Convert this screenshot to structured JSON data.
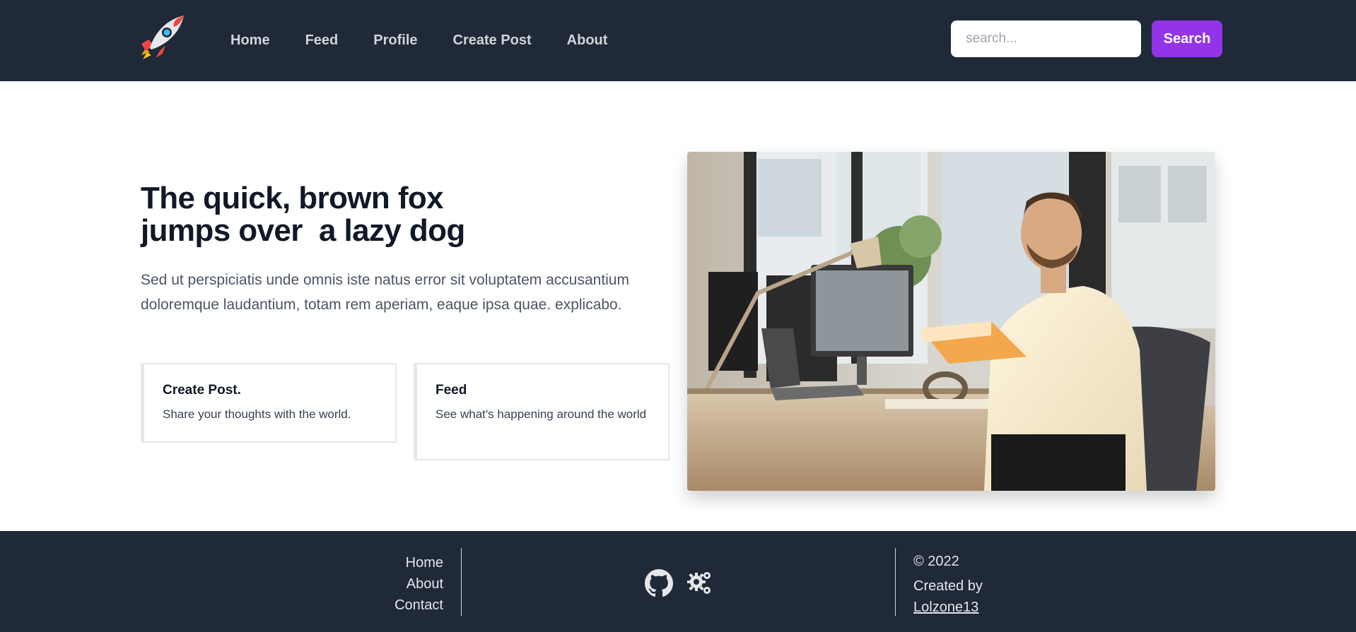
{
  "navbar": {
    "logo_icon": "rocket-icon",
    "links": [
      "Home",
      "Feed",
      "Profile",
      "Create Post",
      "About"
    ],
    "search_placeholder": "search...",
    "search_button": "Search",
    "colors": {
      "background": "#1f2937",
      "accent": "#9333ea"
    }
  },
  "hero": {
    "title_line1": "The quick, brown fox",
    "title_line2": "jumps over  a lazy dog",
    "description": "Sed ut perspiciatis unde omnis iste natus error sit voluptatem accusantium doloremque laudantium, totam rem aperiam, eaque ipsa quae. explicabo.",
    "cards": [
      {
        "title": "Create Post.",
        "text": "Share your thoughts with the world."
      },
      {
        "title": "Feed",
        "text": "See what's happening around the world"
      }
    ],
    "image_icon": "office-photo"
  },
  "footer": {
    "links": [
      "Home",
      "About",
      "Contact"
    ],
    "icons": [
      "github-icon",
      "gears-icon"
    ],
    "copyright": "© 2022",
    "created_by": "Created by",
    "author": "Lolzone13"
  }
}
